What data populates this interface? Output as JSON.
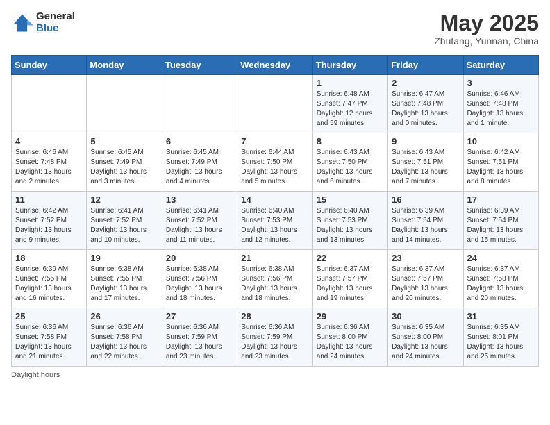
{
  "header": {
    "logo_general": "General",
    "logo_blue": "Blue",
    "title": "May 2025",
    "location": "Zhutang, Yunnan, China"
  },
  "days_of_week": [
    "Sunday",
    "Monday",
    "Tuesday",
    "Wednesday",
    "Thursday",
    "Friday",
    "Saturday"
  ],
  "weeks": [
    [
      {
        "num": "",
        "info": ""
      },
      {
        "num": "",
        "info": ""
      },
      {
        "num": "",
        "info": ""
      },
      {
        "num": "",
        "info": ""
      },
      {
        "num": "1",
        "info": "Sunrise: 6:48 AM\nSunset: 7:47 PM\nDaylight: 12 hours and 59 minutes."
      },
      {
        "num": "2",
        "info": "Sunrise: 6:47 AM\nSunset: 7:48 PM\nDaylight: 13 hours and 0 minutes."
      },
      {
        "num": "3",
        "info": "Sunrise: 6:46 AM\nSunset: 7:48 PM\nDaylight: 13 hours and 1 minute."
      }
    ],
    [
      {
        "num": "4",
        "info": "Sunrise: 6:46 AM\nSunset: 7:48 PM\nDaylight: 13 hours and 2 minutes."
      },
      {
        "num": "5",
        "info": "Sunrise: 6:45 AM\nSunset: 7:49 PM\nDaylight: 13 hours and 3 minutes."
      },
      {
        "num": "6",
        "info": "Sunrise: 6:45 AM\nSunset: 7:49 PM\nDaylight: 13 hours and 4 minutes."
      },
      {
        "num": "7",
        "info": "Sunrise: 6:44 AM\nSunset: 7:50 PM\nDaylight: 13 hours and 5 minutes."
      },
      {
        "num": "8",
        "info": "Sunrise: 6:43 AM\nSunset: 7:50 PM\nDaylight: 13 hours and 6 minutes."
      },
      {
        "num": "9",
        "info": "Sunrise: 6:43 AM\nSunset: 7:51 PM\nDaylight: 13 hours and 7 minutes."
      },
      {
        "num": "10",
        "info": "Sunrise: 6:42 AM\nSunset: 7:51 PM\nDaylight: 13 hours and 8 minutes."
      }
    ],
    [
      {
        "num": "11",
        "info": "Sunrise: 6:42 AM\nSunset: 7:52 PM\nDaylight: 13 hours and 9 minutes."
      },
      {
        "num": "12",
        "info": "Sunrise: 6:41 AM\nSunset: 7:52 PM\nDaylight: 13 hours and 10 minutes."
      },
      {
        "num": "13",
        "info": "Sunrise: 6:41 AM\nSunset: 7:52 PM\nDaylight: 13 hours and 11 minutes."
      },
      {
        "num": "14",
        "info": "Sunrise: 6:40 AM\nSunset: 7:53 PM\nDaylight: 13 hours and 12 minutes."
      },
      {
        "num": "15",
        "info": "Sunrise: 6:40 AM\nSunset: 7:53 PM\nDaylight: 13 hours and 13 minutes."
      },
      {
        "num": "16",
        "info": "Sunrise: 6:39 AM\nSunset: 7:54 PM\nDaylight: 13 hours and 14 minutes."
      },
      {
        "num": "17",
        "info": "Sunrise: 6:39 AM\nSunset: 7:54 PM\nDaylight: 13 hours and 15 minutes."
      }
    ],
    [
      {
        "num": "18",
        "info": "Sunrise: 6:39 AM\nSunset: 7:55 PM\nDaylight: 13 hours and 16 minutes."
      },
      {
        "num": "19",
        "info": "Sunrise: 6:38 AM\nSunset: 7:55 PM\nDaylight: 13 hours and 17 minutes."
      },
      {
        "num": "20",
        "info": "Sunrise: 6:38 AM\nSunset: 7:56 PM\nDaylight: 13 hours and 18 minutes."
      },
      {
        "num": "21",
        "info": "Sunrise: 6:38 AM\nSunset: 7:56 PM\nDaylight: 13 hours and 18 minutes."
      },
      {
        "num": "22",
        "info": "Sunrise: 6:37 AM\nSunset: 7:57 PM\nDaylight: 13 hours and 19 minutes."
      },
      {
        "num": "23",
        "info": "Sunrise: 6:37 AM\nSunset: 7:57 PM\nDaylight: 13 hours and 20 minutes."
      },
      {
        "num": "24",
        "info": "Sunrise: 6:37 AM\nSunset: 7:58 PM\nDaylight: 13 hours and 20 minutes."
      }
    ],
    [
      {
        "num": "25",
        "info": "Sunrise: 6:36 AM\nSunset: 7:58 PM\nDaylight: 13 hours and 21 minutes."
      },
      {
        "num": "26",
        "info": "Sunrise: 6:36 AM\nSunset: 7:58 PM\nDaylight: 13 hours and 22 minutes."
      },
      {
        "num": "27",
        "info": "Sunrise: 6:36 AM\nSunset: 7:59 PM\nDaylight: 13 hours and 23 minutes."
      },
      {
        "num": "28",
        "info": "Sunrise: 6:36 AM\nSunset: 7:59 PM\nDaylight: 13 hours and 23 minutes."
      },
      {
        "num": "29",
        "info": "Sunrise: 6:36 AM\nSunset: 8:00 PM\nDaylight: 13 hours and 24 minutes."
      },
      {
        "num": "30",
        "info": "Sunrise: 6:35 AM\nSunset: 8:00 PM\nDaylight: 13 hours and 24 minutes."
      },
      {
        "num": "31",
        "info": "Sunrise: 6:35 AM\nSunset: 8:01 PM\nDaylight: 13 hours and 25 minutes."
      }
    ]
  ],
  "footer": "Daylight hours"
}
